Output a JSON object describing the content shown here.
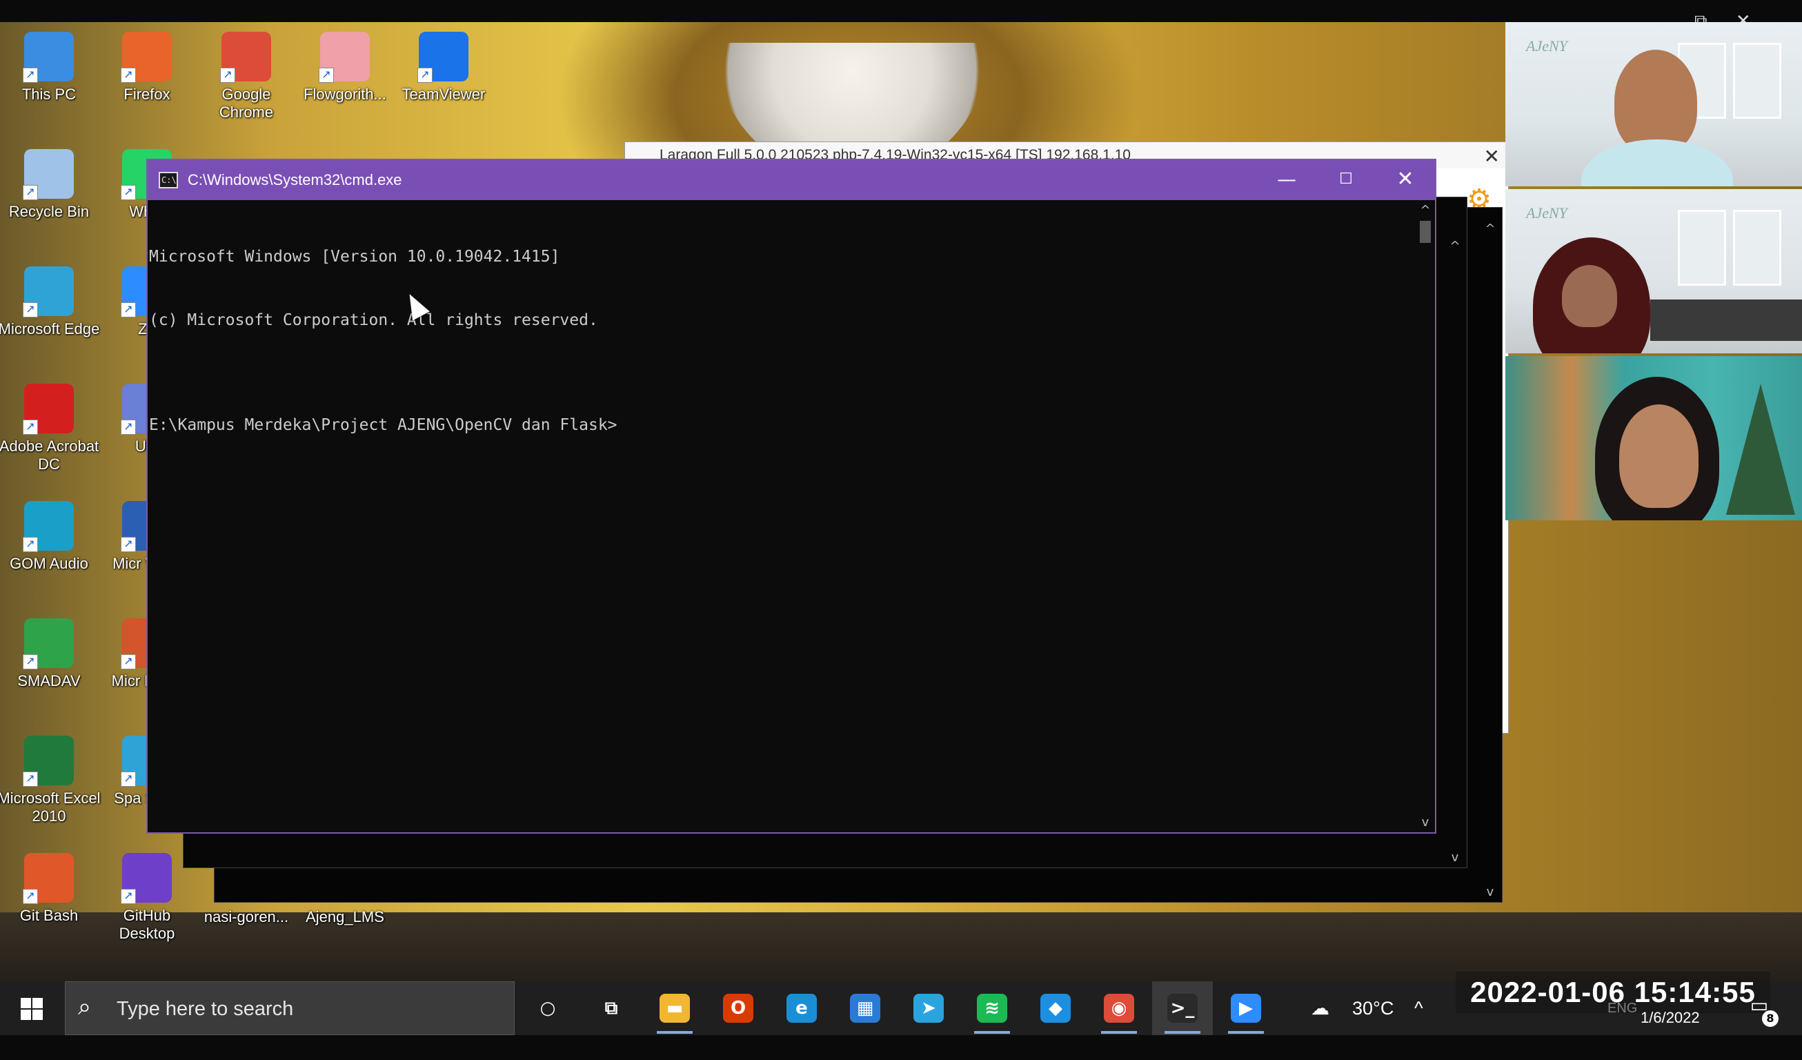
{
  "desktop": {
    "icons_col1": [
      {
        "label": "This PC",
        "icon": "computer-icon",
        "color": "#3a8de0"
      },
      {
        "label": "Recycle Bin",
        "icon": "recycle-bin-icon",
        "color": "#9fc2e8"
      },
      {
        "label": "Microsoft Edge",
        "icon": "edge-icon",
        "color": "#2fa3d6"
      },
      {
        "label": "Adobe Acrobat DC",
        "icon": "acrobat-icon",
        "color": "#d41f1f"
      },
      {
        "label": "GOM Audio",
        "icon": "gom-audio-icon",
        "color": "#1aa0c8"
      },
      {
        "label": "SMADAV",
        "icon": "smadav-icon",
        "color": "#2fa34a"
      },
      {
        "label": "Microsoft Excel 2010",
        "icon": "excel-icon",
        "color": "#1f7a3c"
      },
      {
        "label": "Git Bash",
        "icon": "git-bash-icon",
        "color": "#e0572a"
      }
    ],
    "icons_col2": [
      {
        "label": "Firefox",
        "icon": "firefox-icon",
        "color": "#e8642a"
      },
      {
        "label": "What",
        "icon": "whatsapp-icon",
        "color": "#25d366"
      },
      {
        "label": "Zo",
        "icon": "zoom-icon",
        "color": "#2d8cff"
      },
      {
        "label": "Ultr",
        "icon": "ultra-icon",
        "color": "#6a7fd6"
      },
      {
        "label": "Micr Word",
        "icon": "word-icon",
        "color": "#2b5fb4"
      },
      {
        "label": "Micr Powe",
        "icon": "powerpoint-icon",
        "color": "#d2552c"
      },
      {
        "label": "Spa Studi",
        "icon": "spark-icon",
        "color": "#2fa3d6"
      },
      {
        "label": "GitHub Desktop",
        "icon": "github-desktop-icon",
        "color": "#6e40c9"
      }
    ],
    "icons_top": [
      {
        "label": "Google Chrome",
        "icon": "chrome-icon",
        "color": "#dd4b39"
      },
      {
        "label": "Flowgorith...",
        "icon": "flowgorithm-icon",
        "color": "#f0a0a8"
      },
      {
        "label": "TeamViewer",
        "icon": "teamviewer-icon",
        "color": "#1a73e8"
      }
    ],
    "icons_bottom": [
      {
        "label": "nasi-goren...",
        "icon": "folder-icon"
      },
      {
        "label": "Ajeng_LMS",
        "icon": "folder-icon"
      }
    ]
  },
  "laragon": {
    "title": "Laragon Full 5.0.0 210523 php-7.4.19-Win32-vc15-x64 [TS] 192.168.1.10"
  },
  "cmd": {
    "title": "C:\\Windows\\System32\\cmd.exe",
    "lines": [
      "Microsoft Windows [Version 10.0.19042.1415]",
      "(c) Microsoft Corporation. All rights reserved.",
      "",
      "E:\\Kampus Merdeka\\Project AJENG\\OpenCV dan Flask>"
    ],
    "minimize_glyph": "—",
    "maximize_glyph": "☐",
    "close_glyph": "✕"
  },
  "video_tiles": [
    {
      "logo": "AJeNY"
    },
    {
      "logo": "AJeNY"
    },
    {
      "logo": ""
    }
  ],
  "taskbar": {
    "search_placeholder": "Type here to search",
    "apps": [
      {
        "name": "cortana",
        "glyph": "○",
        "color": "#1f1f1f"
      },
      {
        "name": "task-view",
        "glyph": "⧉",
        "color": "#1f1f1f"
      },
      {
        "name": "file-explorer",
        "glyph": "▬",
        "color": "#f2b632"
      },
      {
        "name": "office",
        "glyph": "O",
        "color": "#d83b01"
      },
      {
        "name": "edge",
        "glyph": "e",
        "color": "#1a8fd6"
      },
      {
        "name": "store",
        "glyph": "▦",
        "color": "#2a7bd6"
      },
      {
        "name": "telegram",
        "glyph": "➤",
        "color": "#2aa3df"
      },
      {
        "name": "spotify",
        "glyph": "≋",
        "color": "#1db954"
      },
      {
        "name": "app-blue",
        "glyph": "◆",
        "color": "#1d8fe0"
      },
      {
        "name": "chrome",
        "glyph": "◉",
        "color": "#dd4b39"
      },
      {
        "name": "cmd",
        "glyph": ">_",
        "color": "#2a2a2a"
      },
      {
        "name": "zoom",
        "glyph": "▶",
        "color": "#2d8cff"
      }
    ],
    "weather": "30°C",
    "language": "ENG",
    "date": "1/6/2022",
    "notifications": "8"
  },
  "recording_timestamp": "2022-01-06  15:14:55"
}
